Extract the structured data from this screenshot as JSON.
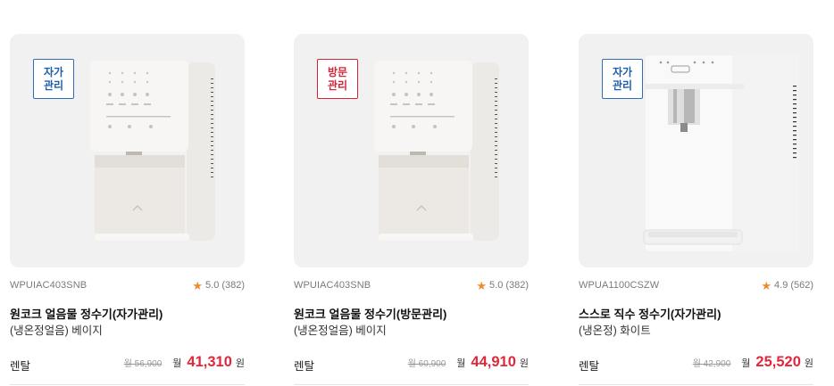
{
  "products": [
    {
      "badge": "자가\n관리",
      "badge_type": "self",
      "model": "WPUIAC403SNB",
      "rating": "5.0",
      "reviews": "(382)",
      "title": "원코크 얼음물 정수기(자가관리)",
      "subtitle": "(냉온정얼음) 베이지",
      "rental_label": "렌탈",
      "original_price": "월 56,900",
      "month_label": "월",
      "price": "41,310",
      "currency": "원",
      "image_icon": "ice-water-purifier-image"
    },
    {
      "badge": "방문\n관리",
      "badge_type": "visit",
      "model": "WPUIAC403SNB",
      "rating": "5.0",
      "reviews": "(382)",
      "title": "원코크 얼음물 정수기(방문관리)",
      "subtitle": "(냉온정얼음) 베이지",
      "rental_label": "렌탈",
      "original_price": "월 60,900",
      "month_label": "월",
      "price": "44,910",
      "currency": "원",
      "image_icon": "ice-water-purifier-image"
    },
    {
      "badge": "자가\n관리",
      "badge_type": "self",
      "model": "WPUA1100CSZW",
      "rating": "4.9",
      "reviews": "(562)",
      "title": "스스로 직수 정수기(자가관리)",
      "subtitle": "(냉온정) 화이트",
      "rental_label": "렌탈",
      "original_price": "월 42,900",
      "month_label": "월",
      "price": "25,520",
      "currency": "원",
      "image_icon": "direct-water-purifier-image"
    }
  ],
  "colors": {
    "price": "#e0283a",
    "star": "#f08a2c",
    "badge_self": "#1f5fa8",
    "badge_visit": "#d0253a",
    "card_bg": "#f1f1f1"
  }
}
